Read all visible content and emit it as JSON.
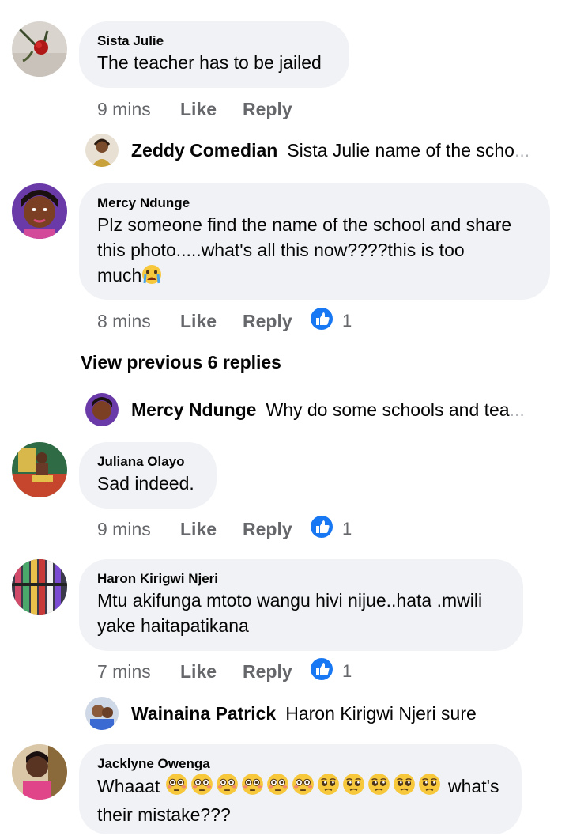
{
  "comments": [
    {
      "author": "Sista Julie",
      "text": "The teacher has to be jailed",
      "time": "9 mins",
      "like": "Like",
      "reply": "Reply"
    },
    {
      "author": "Mercy Ndunge",
      "text_lines": [
        "Plz someone find the name of the school and share",
        "this photo.....what's all this now????this is too",
        "much"
      ],
      "emoji": "crying-face",
      "time": "8 mins",
      "like": "Like",
      "reply": "Reply",
      "reactions": "1"
    },
    {
      "author": "Juliana Olayo",
      "text": "Sad indeed.",
      "time": "9 mins",
      "like": "Like",
      "reply": "Reply",
      "reactions": "1"
    },
    {
      "author": "Haron Kirigwi Njeri",
      "text_lines": [
        "Mtu akifunga mtoto wangu hivi nijue..hata .mwili",
        "yake haitapatikana"
      ],
      "time": "7 mins",
      "like": "Like",
      "reply": "Reply",
      "reactions": "1"
    },
    {
      "author": "Jacklyne Owenga",
      "text_start": "Whaaat",
      "emojis": [
        "flushed-face",
        "flushed-face",
        "flushed-face",
        "flushed-face",
        "flushed-face",
        "flushed-face",
        "pleading-face",
        "pleading-face",
        "pleading-face",
        "pleading-face",
        "pleading-face"
      ],
      "text_end": "what's",
      "text_line2": "their mistake???"
    }
  ],
  "replies": [
    {
      "author": "Zeddy Comedian",
      "text": "Sista Julie name of the scho",
      "ellipsis": "..."
    },
    {
      "author": "Mercy Ndunge",
      "text": "Why do some schools and tea",
      "ellipsis": "..."
    },
    {
      "author": "Wainaina Patrick",
      "text": "Haron Kirigwi Njeri sure"
    }
  ],
  "view_previous": "View previous 6 replies",
  "colors": {
    "bubble": "#f0f2f5",
    "meta": "#65676b",
    "like_blue": "#1877f2"
  }
}
